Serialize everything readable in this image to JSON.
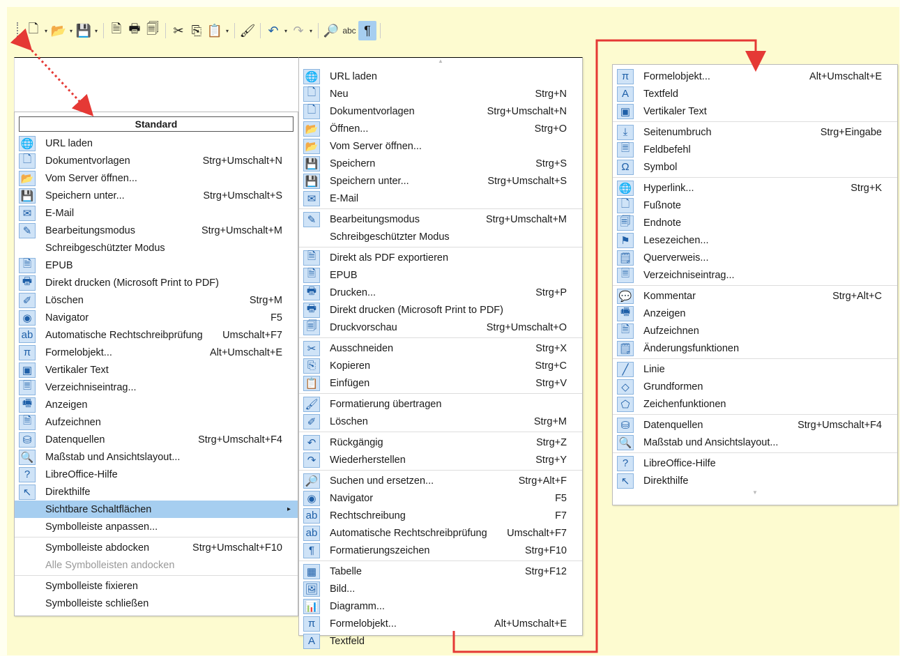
{
  "toolbar": {
    "buttons": [
      "new-document-icon",
      "open-folder-icon",
      "save-icon",
      "export-pdf-icon",
      "print-icon",
      "print-preview-icon",
      "cut-icon",
      "copy-icon",
      "paste-icon",
      "clone-formatting-icon",
      "undo-icon",
      "redo-icon",
      "find-replace-icon",
      "spellcheck-icon",
      "formatting-marks-icon"
    ],
    "spell_label": "abc",
    "pilcrow": "¶"
  },
  "menu1": {
    "title": "Standard",
    "items": [
      {
        "label": "URL laden",
        "sc": "",
        "icon": "🌐"
      },
      {
        "label": "Dokumentvorlagen",
        "sc": "Strg+Umschalt+N",
        "icon": "🗋"
      },
      {
        "label": "Vom Server öffnen...",
        "sc": "",
        "icon": "📂"
      },
      {
        "label": "Speichern unter...",
        "sc": "Strg+Umschalt+S",
        "icon": "💾"
      },
      {
        "label": "E-Mail",
        "sc": "",
        "icon": "✉"
      },
      {
        "label": "Bearbeitungsmodus",
        "sc": "Strg+Umschalt+M",
        "icon": "✎"
      },
      {
        "label": "Schreibgeschützter Modus",
        "sc": "",
        "icon": ""
      },
      {
        "label": "EPUB",
        "sc": "",
        "icon": "🗎"
      },
      {
        "label": "Direkt drucken (Microsoft Print to PDF)",
        "sc": "",
        "icon": "🖶"
      },
      {
        "label": "Löschen",
        "sc": "Strg+M",
        "icon": "✐"
      },
      {
        "label": "Navigator",
        "sc": "F5",
        "icon": "◉"
      },
      {
        "label": "Automatische Rechtschreibprüfung",
        "sc": "Umschalt+F7",
        "icon": "ab"
      },
      {
        "label": "Formelobjekt...",
        "sc": "Alt+Umschalt+E",
        "icon": "π"
      },
      {
        "label": "Vertikaler Text",
        "sc": "",
        "icon": "▣"
      },
      {
        "label": "Verzeichniseintrag...",
        "sc": "",
        "icon": "🗏"
      },
      {
        "label": "Anzeigen",
        "sc": "",
        "icon": "🖷"
      },
      {
        "label": "Aufzeichnen",
        "sc": "",
        "icon": "🗎"
      },
      {
        "label": "Datenquellen",
        "sc": "Strg+Umschalt+F4",
        "icon": "⛁"
      },
      {
        "label": "Maßstab und Ansichtslayout...",
        "sc": "",
        "icon": "🔍"
      },
      {
        "label": "LibreOffice-Hilfe",
        "sc": "",
        "icon": "?"
      },
      {
        "label": "Direkthilfe",
        "sc": "",
        "icon": "↖"
      }
    ],
    "bottom": [
      {
        "label": "Sichtbare Schaltflächen",
        "sc": ""
      },
      {
        "label": "Symbolleiste anpassen...",
        "sc": ""
      },
      {
        "label": "Symbolleiste abdocken",
        "sc": "Strg+Umschalt+F10"
      },
      {
        "label": "Alle Symbolleisten andocken",
        "sc": ""
      },
      {
        "label": "Symbolleiste fixieren",
        "sc": ""
      },
      {
        "label": "Symbolleiste schließen",
        "sc": ""
      }
    ]
  },
  "menu2": {
    "groups": [
      [
        {
          "label": "URL laden",
          "sc": "",
          "icon": "🌐"
        },
        {
          "label": "Neu",
          "sc": "Strg+N",
          "icon": "🗋"
        },
        {
          "label": "Dokumentvorlagen",
          "sc": "Strg+Umschalt+N",
          "icon": "🗋"
        },
        {
          "label": "Öffnen...",
          "sc": "Strg+O",
          "icon": "📂"
        },
        {
          "label": "Vom Server öffnen...",
          "sc": "",
          "icon": "📂"
        },
        {
          "label": "Speichern",
          "sc": "Strg+S",
          "icon": "💾"
        },
        {
          "label": "Speichern unter...",
          "sc": "Strg+Umschalt+S",
          "icon": "💾"
        },
        {
          "label": "E-Mail",
          "sc": "",
          "icon": "✉"
        }
      ],
      [
        {
          "label": "Bearbeitungsmodus",
          "sc": "Strg+Umschalt+M",
          "icon": "✎"
        },
        {
          "label": "Schreibgeschützter Modus",
          "sc": "",
          "icon": ""
        }
      ],
      [
        {
          "label": "Direkt als PDF exportieren",
          "sc": "",
          "icon": "🗎"
        },
        {
          "label": "EPUB",
          "sc": "",
          "icon": "🗎"
        },
        {
          "label": "Drucken...",
          "sc": "Strg+P",
          "icon": "🖶"
        },
        {
          "label": "Direkt drucken (Microsoft Print to PDF)",
          "sc": "",
          "icon": "🖶"
        },
        {
          "label": "Druckvorschau",
          "sc": "Strg+Umschalt+O",
          "icon": "🗐"
        }
      ],
      [
        {
          "label": "Ausschneiden",
          "sc": "Strg+X",
          "icon": "✂"
        },
        {
          "label": "Kopieren",
          "sc": "Strg+C",
          "icon": "⎘"
        },
        {
          "label": "Einfügen",
          "sc": "Strg+V",
          "icon": "📋"
        }
      ],
      [
        {
          "label": "Formatierung übertragen",
          "sc": "",
          "icon": "🖌"
        },
        {
          "label": "Löschen",
          "sc": "Strg+M",
          "icon": "✐"
        }
      ],
      [
        {
          "label": "Rückgängig",
          "sc": "Strg+Z",
          "icon": "↶"
        },
        {
          "label": "Wiederherstellen",
          "sc": "Strg+Y",
          "icon": "↷"
        }
      ],
      [
        {
          "label": "Suchen und ersetzen...",
          "sc": "Strg+Alt+F",
          "icon": "🔎"
        },
        {
          "label": "Navigator",
          "sc": "F5",
          "icon": "◉"
        },
        {
          "label": "Rechtschreibung",
          "sc": "F7",
          "icon": "ab"
        },
        {
          "label": "Automatische Rechtschreibprüfung",
          "sc": "Umschalt+F7",
          "icon": "ab"
        },
        {
          "label": "Formatierungszeichen",
          "sc": "Strg+F10",
          "icon": "¶"
        }
      ],
      [
        {
          "label": "Tabelle",
          "sc": "Strg+F12",
          "icon": "▦"
        },
        {
          "label": "Bild...",
          "sc": "",
          "icon": "🖼"
        },
        {
          "label": "Diagramm...",
          "sc": "",
          "icon": "📊"
        },
        {
          "label": "Formelobjekt...",
          "sc": "Alt+Umschalt+E",
          "icon": "π"
        },
        {
          "label": "Textfeld",
          "sc": "",
          "icon": "A"
        }
      ]
    ]
  },
  "menu3": {
    "groups": [
      [
        {
          "label": "Formelobjekt...",
          "sc": "Alt+Umschalt+E",
          "icon": "π"
        },
        {
          "label": "Textfeld",
          "sc": "",
          "icon": "A"
        },
        {
          "label": "Vertikaler Text",
          "sc": "",
          "icon": "▣"
        }
      ],
      [
        {
          "label": "Seitenumbruch",
          "sc": "Strg+Eingabe",
          "icon": "⤓"
        },
        {
          "label": "Feldbefehl",
          "sc": "",
          "icon": "🗏"
        },
        {
          "label": "Symbol",
          "sc": "",
          "icon": "Ω"
        }
      ],
      [
        {
          "label": "Hyperlink...",
          "sc": "Strg+K",
          "icon": "🌐"
        },
        {
          "label": "Fußnote",
          "sc": "",
          "icon": "🗋"
        },
        {
          "label": "Endnote",
          "sc": "",
          "icon": "🗐"
        },
        {
          "label": "Lesezeichen...",
          "sc": "",
          "icon": "⚑"
        },
        {
          "label": "Querverweis...",
          "sc": "",
          "icon": "🗒"
        },
        {
          "label": "Verzeichniseintrag...",
          "sc": "",
          "icon": "🗏"
        }
      ],
      [
        {
          "label": "Kommentar",
          "sc": "Strg+Alt+C",
          "icon": "💬"
        },
        {
          "label": "Anzeigen",
          "sc": "",
          "icon": "🖷"
        },
        {
          "label": "Aufzeichnen",
          "sc": "",
          "icon": "🗎"
        },
        {
          "label": "Änderungsfunktionen",
          "sc": "",
          "icon": "🗒"
        }
      ],
      [
        {
          "label": "Linie",
          "sc": "",
          "icon": "╱"
        },
        {
          "label": "Grundformen",
          "sc": "",
          "icon": "◇"
        },
        {
          "label": "Zeichenfunktionen",
          "sc": "",
          "icon": "⬠"
        }
      ],
      [
        {
          "label": "Datenquellen",
          "sc": "Strg+Umschalt+F4",
          "icon": "⛁"
        },
        {
          "label": "Maßstab und Ansichtslayout...",
          "sc": "",
          "icon": "🔍"
        }
      ],
      [
        {
          "label": "LibreOffice-Hilfe",
          "sc": "",
          "icon": "?"
        },
        {
          "label": "Direkthilfe",
          "sc": "",
          "icon": "↖"
        }
      ]
    ]
  },
  "colors": {
    "highlight": "#a6cef0",
    "annotation": "#e53935",
    "panel": "#fdfbd0"
  }
}
